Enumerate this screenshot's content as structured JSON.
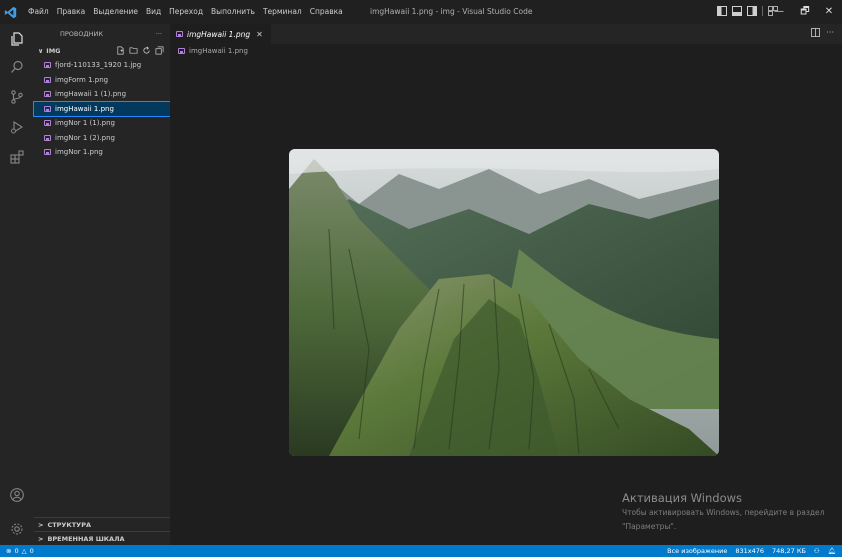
{
  "titlebar": {
    "menu": [
      "Файл",
      "Правка",
      "Выделение",
      "Вид",
      "Переход",
      "Выполнить",
      "Терминал",
      "Справка"
    ],
    "window_title": "imgHawaii 1.png - img - Visual Studio Code",
    "minimize": "—",
    "restore": "🗗",
    "close": "✕"
  },
  "activity_bar": {
    "icons": [
      "explorer-icon",
      "search-icon",
      "source-control-icon",
      "run-debug-icon",
      "extensions-icon",
      "account-icon",
      "settings-gear-icon"
    ]
  },
  "sidebar": {
    "header": "ПРОВОДНИК",
    "more": "···",
    "folder": "IMG",
    "folder_chevron": "∨",
    "files": [
      {
        "name": "fjord-110133_1920 1.jpg"
      },
      {
        "name": "imgForm 1.png"
      },
      {
        "name": "imgHawaii 1 (1).png"
      },
      {
        "name": "imgHawaii 1.png"
      },
      {
        "name": "imgNor 1 (1).png"
      },
      {
        "name": "imgNor 1 (2).png"
      },
      {
        "name": "imgNor 1.png"
      }
    ],
    "selected_index": 3,
    "outline_label": "СТРУКТУРА",
    "timeline_label": "ВРЕМЕННАЯ ШКАЛА",
    "section_chevron": ">"
  },
  "editor": {
    "tab_label": "imgHawaii 1.png",
    "tab_close": "✕",
    "breadcrumb": "imgHawaii 1.png",
    "tab_actions_more": "···"
  },
  "watermark": {
    "title": "Активация Windows",
    "line1": "Чтобы активировать Windows, перейдите в раздел",
    "line2": "\"Параметры\"."
  },
  "statusbar": {
    "errors": "0",
    "warnings": "0",
    "image_label": "Все изображение",
    "dimensions": "831x476",
    "size": "748,27 КБ"
  },
  "colors": {
    "accent": "#007acc",
    "selection": "#04395e",
    "file_icon": "#b180d7"
  }
}
